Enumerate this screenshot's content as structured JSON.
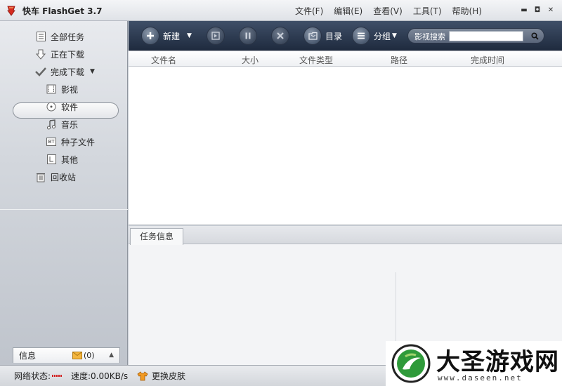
{
  "window": {
    "title": "快车 FlashGet 3.7",
    "controls": [
      "▬",
      "◘",
      "✕"
    ]
  },
  "menu": [
    "文件(F)",
    "编辑(E)",
    "查看(V)",
    "工具(T)",
    "帮助(H)"
  ],
  "sidebar": {
    "items": [
      {
        "label": "全部任务",
        "icon": "list-icon"
      },
      {
        "label": "正在下载",
        "icon": "download-arrow-icon"
      },
      {
        "label": "完成下载",
        "icon": "checkmark-icon"
      },
      {
        "label": "影视",
        "icon": "film-icon"
      },
      {
        "label": "软件",
        "icon": "disc-icon"
      },
      {
        "label": "音乐",
        "icon": "music-note-icon"
      },
      {
        "label": "种子文件",
        "icon": "bt-icon"
      },
      {
        "label": "其他",
        "icon": "file-icon"
      },
      {
        "label": "回收站",
        "icon": "trash-icon"
      }
    ],
    "bt_text": "BT",
    "info_tab": {
      "label": "信息",
      "count": "(0)"
    }
  },
  "toolbar": {
    "new_label": "新建",
    "catalog_label": "目录",
    "group_label": "分组",
    "search_label": "影视搜索",
    "search_value": ""
  },
  "list": {
    "columns": [
      "文件名",
      "大小",
      "文件类型",
      "路径",
      "完成时间"
    ]
  },
  "task_panel": {
    "tab_label": "任务信息"
  },
  "status": {
    "network_label": "网络状态:",
    "speed": "速度:0.00KB/s",
    "skin_label": "更换皮肤"
  },
  "watermark": {
    "title": "大圣游戏网",
    "url": "www.daseen.net"
  },
  "colors": {
    "toolbar_dark": "#1f2b3f",
    "accent_red": "#d21f1f"
  }
}
